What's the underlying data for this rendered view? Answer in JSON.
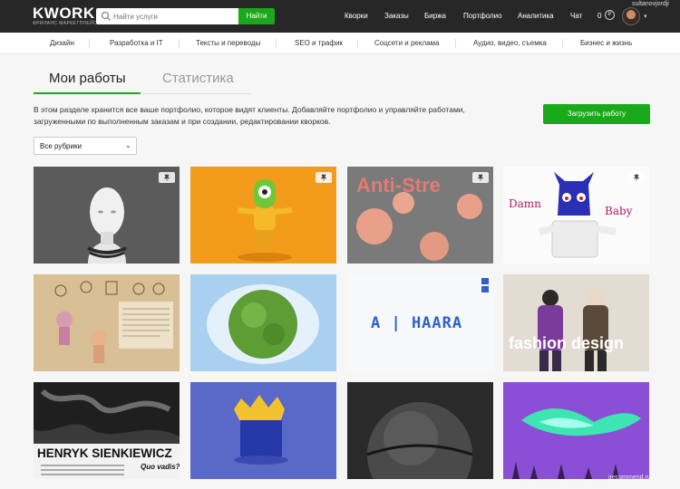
{
  "header": {
    "logo": "KWORK",
    "logo_subtitle": "ФРИЛАНС МАРКЕТПЛЕЙС",
    "search_placeholder": "Найти услуги",
    "search_button": "Найти",
    "nav": [
      "Кворки",
      "Заказы",
      "Биржа",
      "Портфолио",
      "Аналитика",
      "Чат"
    ],
    "balance": "0",
    "currency_symbol": "₽",
    "username": "sultanovjordji"
  },
  "categories": [
    "Дизайн",
    "Разработка и IT",
    "Тексты и переводы",
    "SEO и трафик",
    "Соцсети и реклама",
    "Аудио, видео, съемка",
    "Бизнес и жизнь"
  ],
  "tabs": {
    "active": "Мои работы",
    "inactive": "Статистика"
  },
  "description": "В этом разделе хранится все ваше портфолио, которое видят клиенты. Добавляйте портфолио и управляйте работами, загруженными по выполненным заказам и при создании, редактировании кворков.",
  "upload_button": "Загрузить работу",
  "rubric_select": {
    "selected": "Все рубрики"
  },
  "portfolio": {
    "card3_text": "Anti-Stre",
    "card4_left": "Damn",
    "card4_right": "Baby",
    "card7_text": "A | HAARA",
    "card8_text": "fashion design",
    "card9_title": "HENRYK SIENKIEWICZ",
    "card9_subtitle": "Quo vadis?"
  },
  "colors": {
    "accent": "#1aa91a",
    "topbar": "#272727"
  },
  "watermark": "irecommend.ru"
}
